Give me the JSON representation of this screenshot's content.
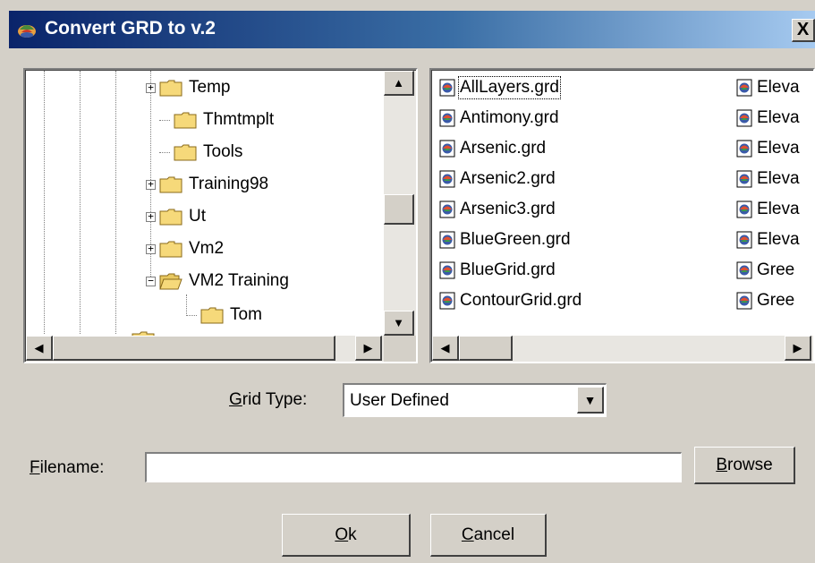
{
  "window": {
    "title": "Convert GRD to v.2",
    "close_label": "X"
  },
  "tree": {
    "items": [
      {
        "label": "Temp",
        "expander": "+"
      },
      {
        "label": "Thmtmplt",
        "expander": ""
      },
      {
        "label": "Tools",
        "expander": ""
      },
      {
        "label": "Training98",
        "expander": "+"
      },
      {
        "label": "Ut",
        "expander": "+"
      },
      {
        "label": "Vm2",
        "expander": "+"
      },
      {
        "label": "VM2 Training",
        "expander": "−"
      },
      {
        "label": "Tom",
        "expander": ""
      }
    ]
  },
  "files": {
    "column1": [
      "AllLayers.grd",
      "Antimony.grd",
      "Arsenic.grd",
      "Arsenic2.grd",
      "Arsenic3.grd",
      "BlueGreen.grd",
      "BlueGrid.grd",
      "ContourGrid.grd"
    ],
    "column2": [
      "Eleva",
      "Eleva",
      "Eleva",
      "Eleva",
      "Eleva",
      "Eleva",
      "Gree",
      "Gree"
    ]
  },
  "grid_type": {
    "label_prefix": "G",
    "label_rest": "rid Type:",
    "value": "User Defined"
  },
  "filename": {
    "label_prefix": "F",
    "label_rest": "ilename:",
    "value": ""
  },
  "buttons": {
    "browse_prefix": "B",
    "browse_rest": "rowse",
    "ok_prefix": "O",
    "ok_rest": "k",
    "cancel_prefix": "C",
    "cancel_rest": "ancel"
  }
}
